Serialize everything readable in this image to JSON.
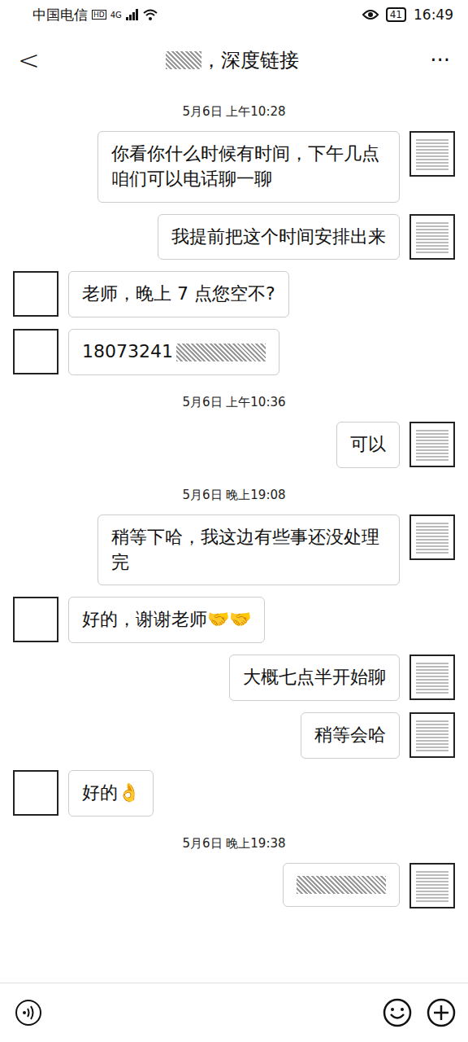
{
  "status_bar": {
    "carrier": "中国电信",
    "hd": "HD",
    "network": "4G",
    "battery": "41",
    "time": "16:49"
  },
  "header": {
    "back": "<",
    "title": "，深度链接",
    "title_redacted": true,
    "more": "···"
  },
  "messages": [
    {
      "kind": "time",
      "text": "5月6日 上午10:28"
    },
    {
      "kind": "message",
      "side": "right",
      "text": "你看你什么时候有时间，下午几点咱们可以电话聊一聊",
      "redacted": false
    },
    {
      "kind": "message",
      "side": "right",
      "text": "我提前把这个时间安排出来",
      "redacted": false
    },
    {
      "kind": "message",
      "side": "left",
      "text": "老师，晚上 7 点您空不?",
      "redacted": false
    },
    {
      "kind": "message",
      "side": "left",
      "text": "18073241",
      "redacted": true
    },
    {
      "kind": "time",
      "text": "5月6日 上午10:36"
    },
    {
      "kind": "message",
      "side": "right",
      "text": "可以",
      "redacted": false
    },
    {
      "kind": "time",
      "text": "5月6日 晚上19:08"
    },
    {
      "kind": "message",
      "side": "right",
      "text": "稍等下哈，我这边有些事还没处理完",
      "redacted": false
    },
    {
      "kind": "message",
      "side": "left",
      "text": "好的，谢谢老师🤝🤝",
      "redacted": false
    },
    {
      "kind": "message",
      "side": "right",
      "text": "大概七点半开始聊",
      "redacted": false
    },
    {
      "kind": "message",
      "side": "right",
      "text": "稍等会哈",
      "redacted": false
    },
    {
      "kind": "message",
      "side": "left",
      "text": "好的👌",
      "redacted": false
    },
    {
      "kind": "time",
      "text": "5月6日 晚上19:38"
    },
    {
      "kind": "message",
      "side": "right",
      "text": "",
      "redacted": true
    }
  ]
}
